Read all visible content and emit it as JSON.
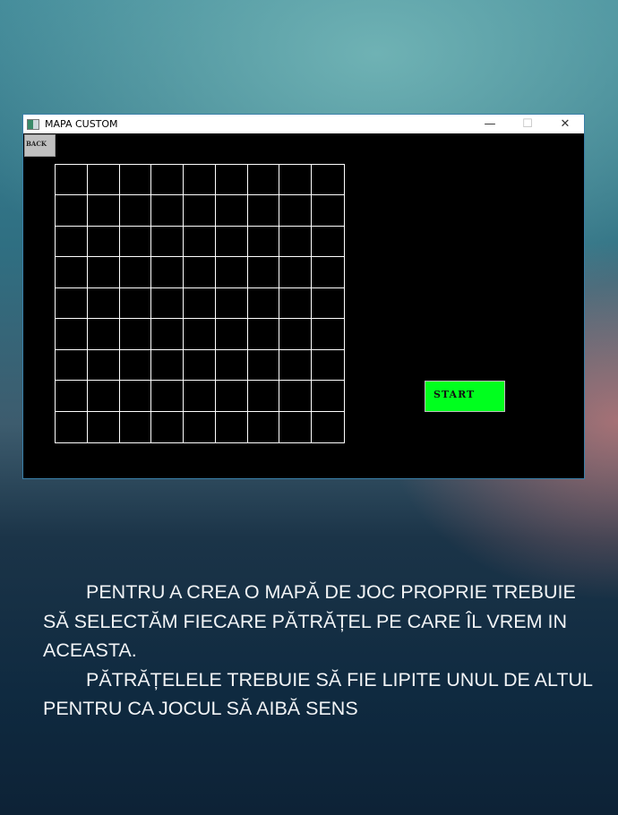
{
  "window": {
    "title": "MAPA  CUSTOM",
    "controls": [
      "—",
      "☐",
      "✕"
    ]
  },
  "back_label": "BACK",
  "grid": {
    "rows": 9,
    "cols": 9
  },
  "start_label": "START",
  "colors": {
    "start": "#00ff1e",
    "back": "#c0c0c0",
    "canvas": "#000000",
    "grid_lines": "#ffffff"
  },
  "description": {
    "p1": "PENTRU A CREA O MAPĂ DE JOC PROPRIE TREBUIE SĂ SELECTĂM FIECARE PĂTRĂȚEL PE CARE ÎL VREM IN ACEASTA.",
    "p2": "PĂTRĂȚELELE TREBUIE SĂ FIE LIPITE UNUL DE ALTUL PENTRU CA JOCUL SĂ  AIBĂ  SENS"
  }
}
